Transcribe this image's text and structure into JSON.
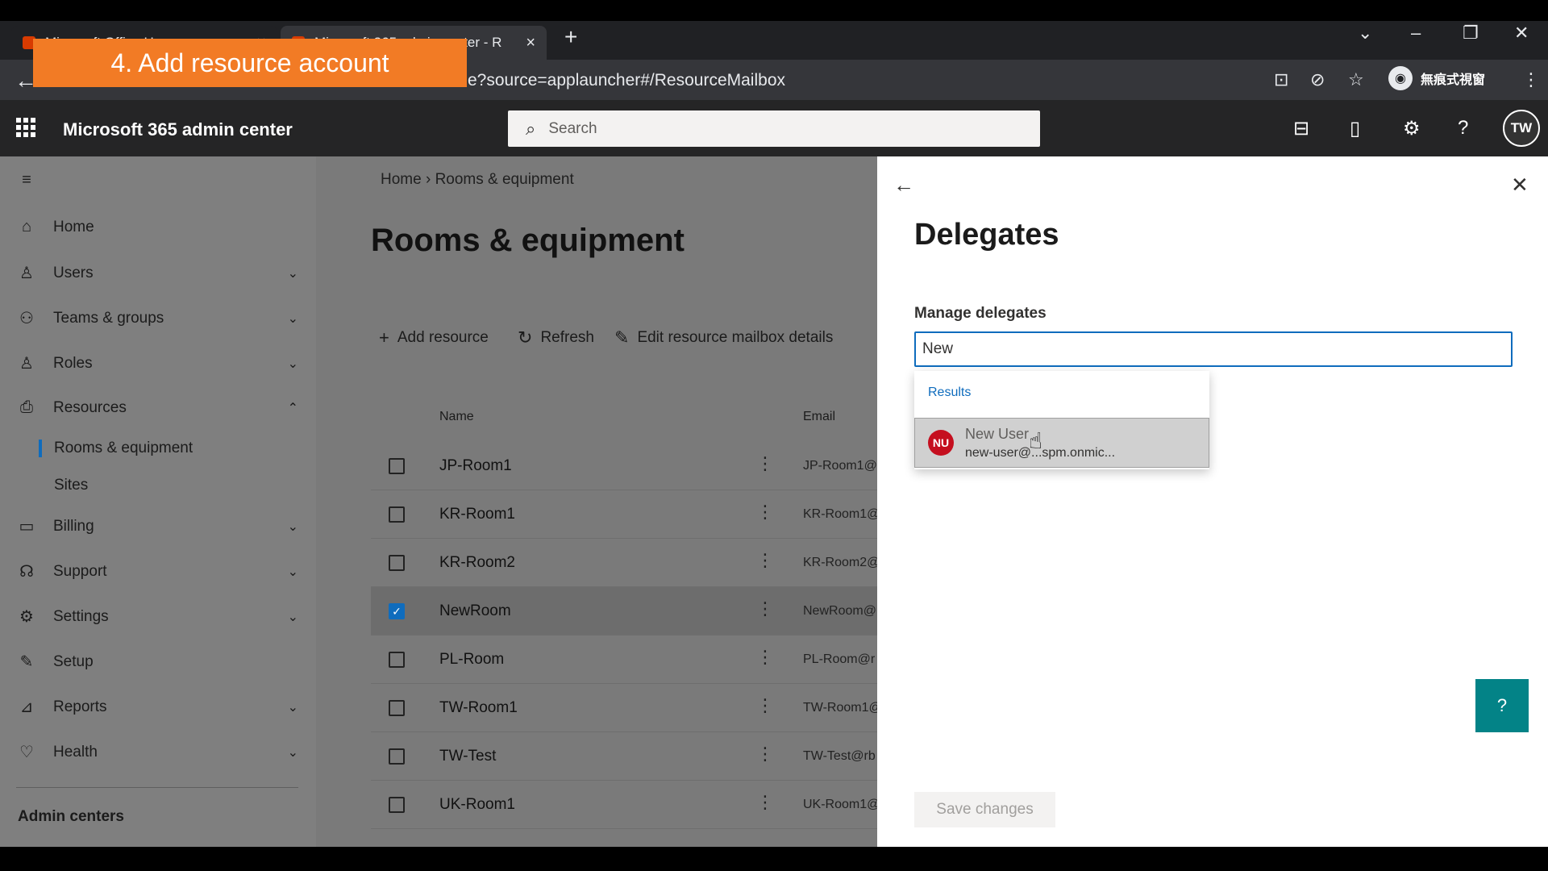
{
  "browser": {
    "tabs": [
      {
        "label": "Microsoft Office H..."
      },
      {
        "label": "Microsoft 365 admin center - R"
      }
    ],
    "url_visible": "e?source=applauncher#/ResourceMailbox",
    "incognito_label": "無痕式視窗"
  },
  "overlay": {
    "banner": "4. Add resource account"
  },
  "header": {
    "app_title": "Microsoft 365 admin center",
    "search_placeholder": "Search",
    "avatar_initials": "TW"
  },
  "sidebar": {
    "items": [
      {
        "label": "Home",
        "icon": "home-icon"
      },
      {
        "label": "Users",
        "icon": "person-icon"
      },
      {
        "label": "Teams & groups",
        "icon": "people-icon"
      },
      {
        "label": "Roles",
        "icon": "roles-icon"
      },
      {
        "label": "Resources",
        "icon": "printer-icon"
      },
      {
        "label": "Billing",
        "icon": "card-icon"
      },
      {
        "label": "Support",
        "icon": "headset-icon"
      },
      {
        "label": "Settings",
        "icon": "gear-icon"
      },
      {
        "label": "Setup",
        "icon": "wrench-icon"
      },
      {
        "label": "Reports",
        "icon": "chart-icon"
      },
      {
        "label": "Health",
        "icon": "heart-icon"
      }
    ],
    "sub_items": [
      "Rooms & equipment",
      "Sites"
    ],
    "admin_centers": "Admin centers"
  },
  "main": {
    "breadcrumb": {
      "home": "Home",
      "current": "Rooms & equipment"
    },
    "title": "Rooms & equipment",
    "toolbar": {
      "add": "Add resource",
      "refresh": "Refresh",
      "edit": "Edit resource mailbox details"
    },
    "columns": {
      "name": "Name",
      "email": "Email"
    },
    "rows": [
      {
        "name": "JP-Room1",
        "email": "JP-Room1@",
        "selected": false
      },
      {
        "name": "KR-Room1",
        "email": "KR-Room1@",
        "selected": false
      },
      {
        "name": "KR-Room2",
        "email": "KR-Room2@",
        "selected": false
      },
      {
        "name": "NewRoom",
        "email": "NewRoom@",
        "selected": true
      },
      {
        "name": "PL-Room",
        "email": "PL-Room@r",
        "selected": false
      },
      {
        "name": "TW-Room1",
        "email": "TW-Room1@",
        "selected": false
      },
      {
        "name": "TW-Test",
        "email": "TW-Test@rb",
        "selected": false
      },
      {
        "name": "UK-Room1",
        "email": "UK-Room1@",
        "selected": false
      }
    ]
  },
  "panel": {
    "title": "Delegates",
    "field_label": "Manage delegates",
    "input_value": "New",
    "results_label": "Results",
    "result": {
      "initials": "NU",
      "name": "New User",
      "email": "new-user@...spm.onmic..."
    },
    "save_label": "Save changes"
  },
  "colors": {
    "accent": "#0f6cbd",
    "persona": "#c50f1f",
    "banner": "#f27b25",
    "fab": "#038387"
  }
}
